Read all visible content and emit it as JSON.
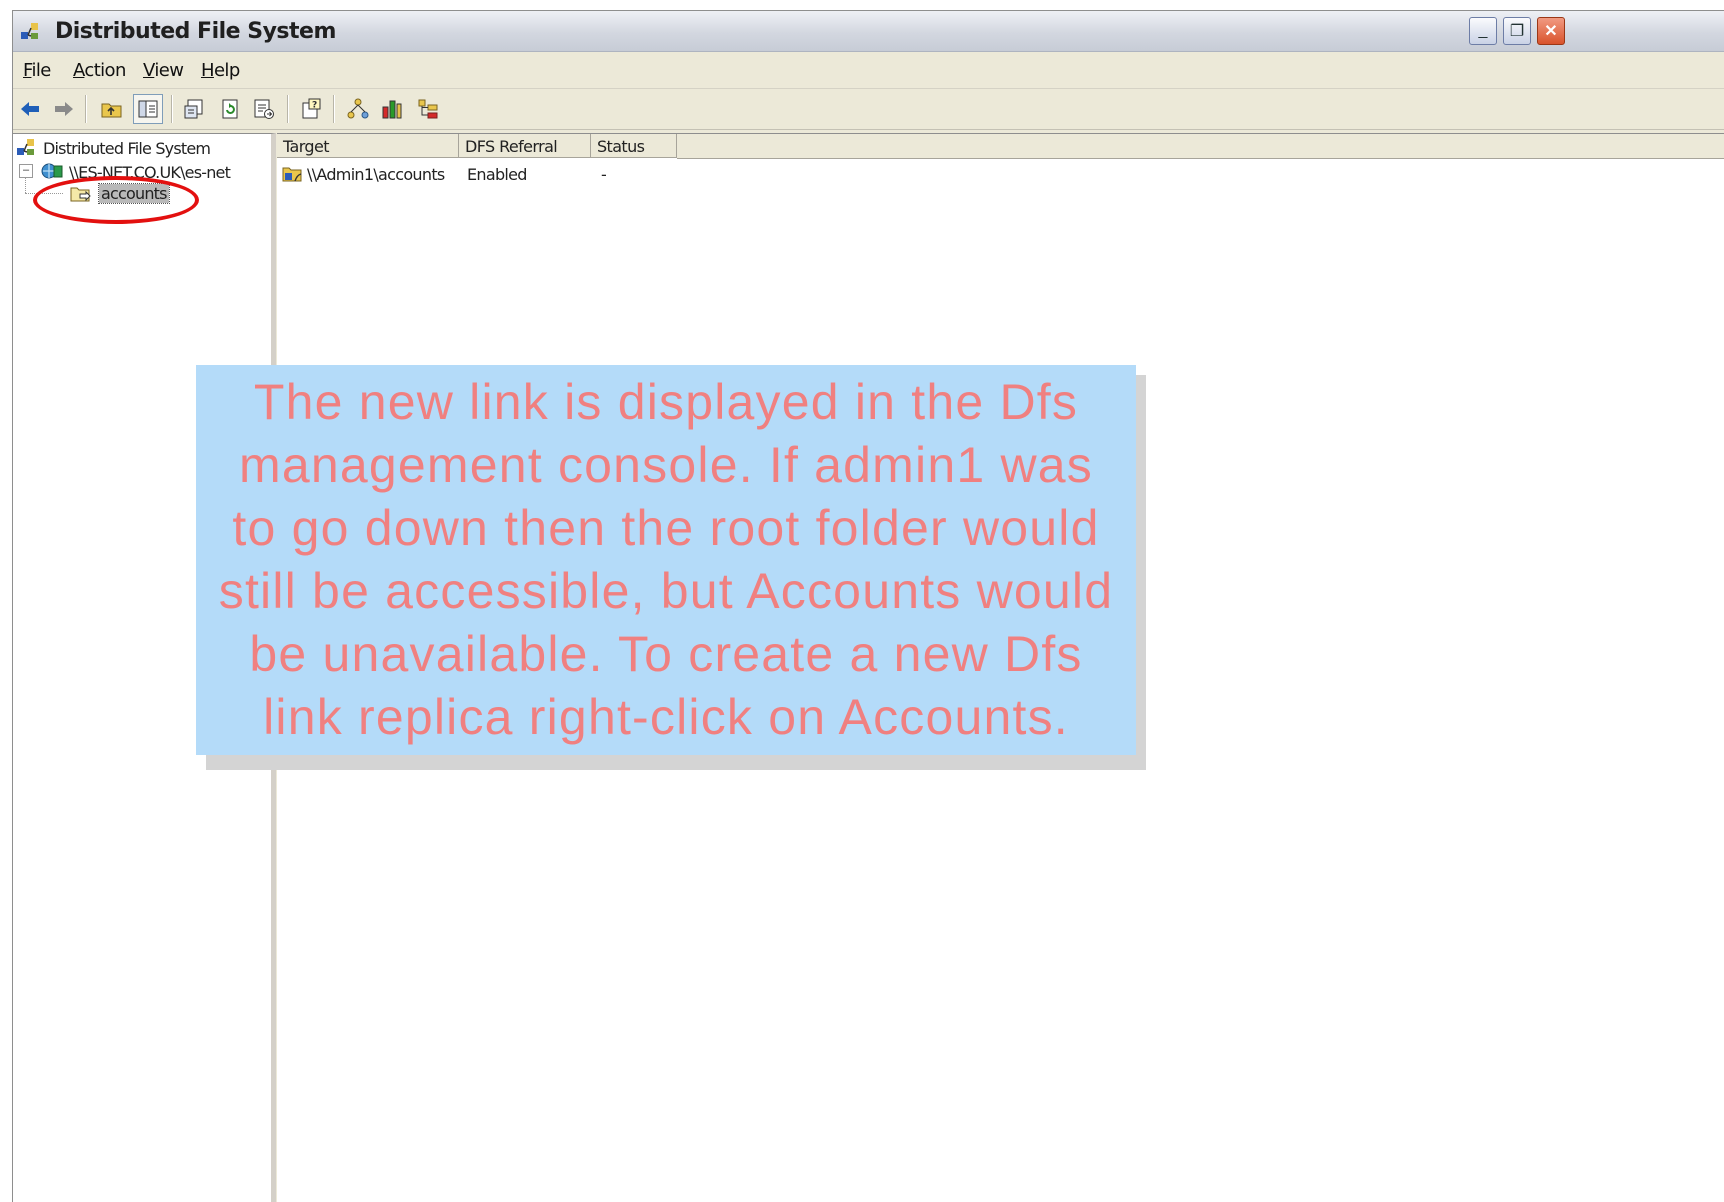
{
  "window": {
    "title": "Distributed File System",
    "buttons": {
      "minimize": "_",
      "restore": "❐",
      "close": "✕"
    }
  },
  "menu": [
    "File",
    "Action",
    "View",
    "Help"
  ],
  "toolbar": {
    "icons": [
      "back-icon",
      "forward-icon",
      "up-folder-icon",
      "show-hide-tree-icon",
      "properties-icon",
      "refresh-icon",
      "export-list-icon",
      "help-icon",
      "replication-icon",
      "status-icon",
      "filter-icon"
    ]
  },
  "tree": {
    "root": "Distributed File System",
    "dfs_root": "\\\\ES-NET.CO.UK\\es-net",
    "selected": "accounts"
  },
  "list": {
    "columns": [
      "Target",
      "DFS Referral",
      "Status"
    ],
    "rows": [
      {
        "target": "\\\\Admin1\\accounts",
        "referral": "Enabled",
        "status": "-"
      }
    ]
  },
  "callout": {
    "text": "The new link is displayed in the Dfs management console. If admin1 was to go down then the root folder would still be accessible, but Accounts would be unavailable. To create a new Dfs link replica right-click on Accounts."
  },
  "colors": {
    "callout_bg": "#b4dbf9",
    "callout_text": "#f08080",
    "highlight": "#e3100f"
  }
}
